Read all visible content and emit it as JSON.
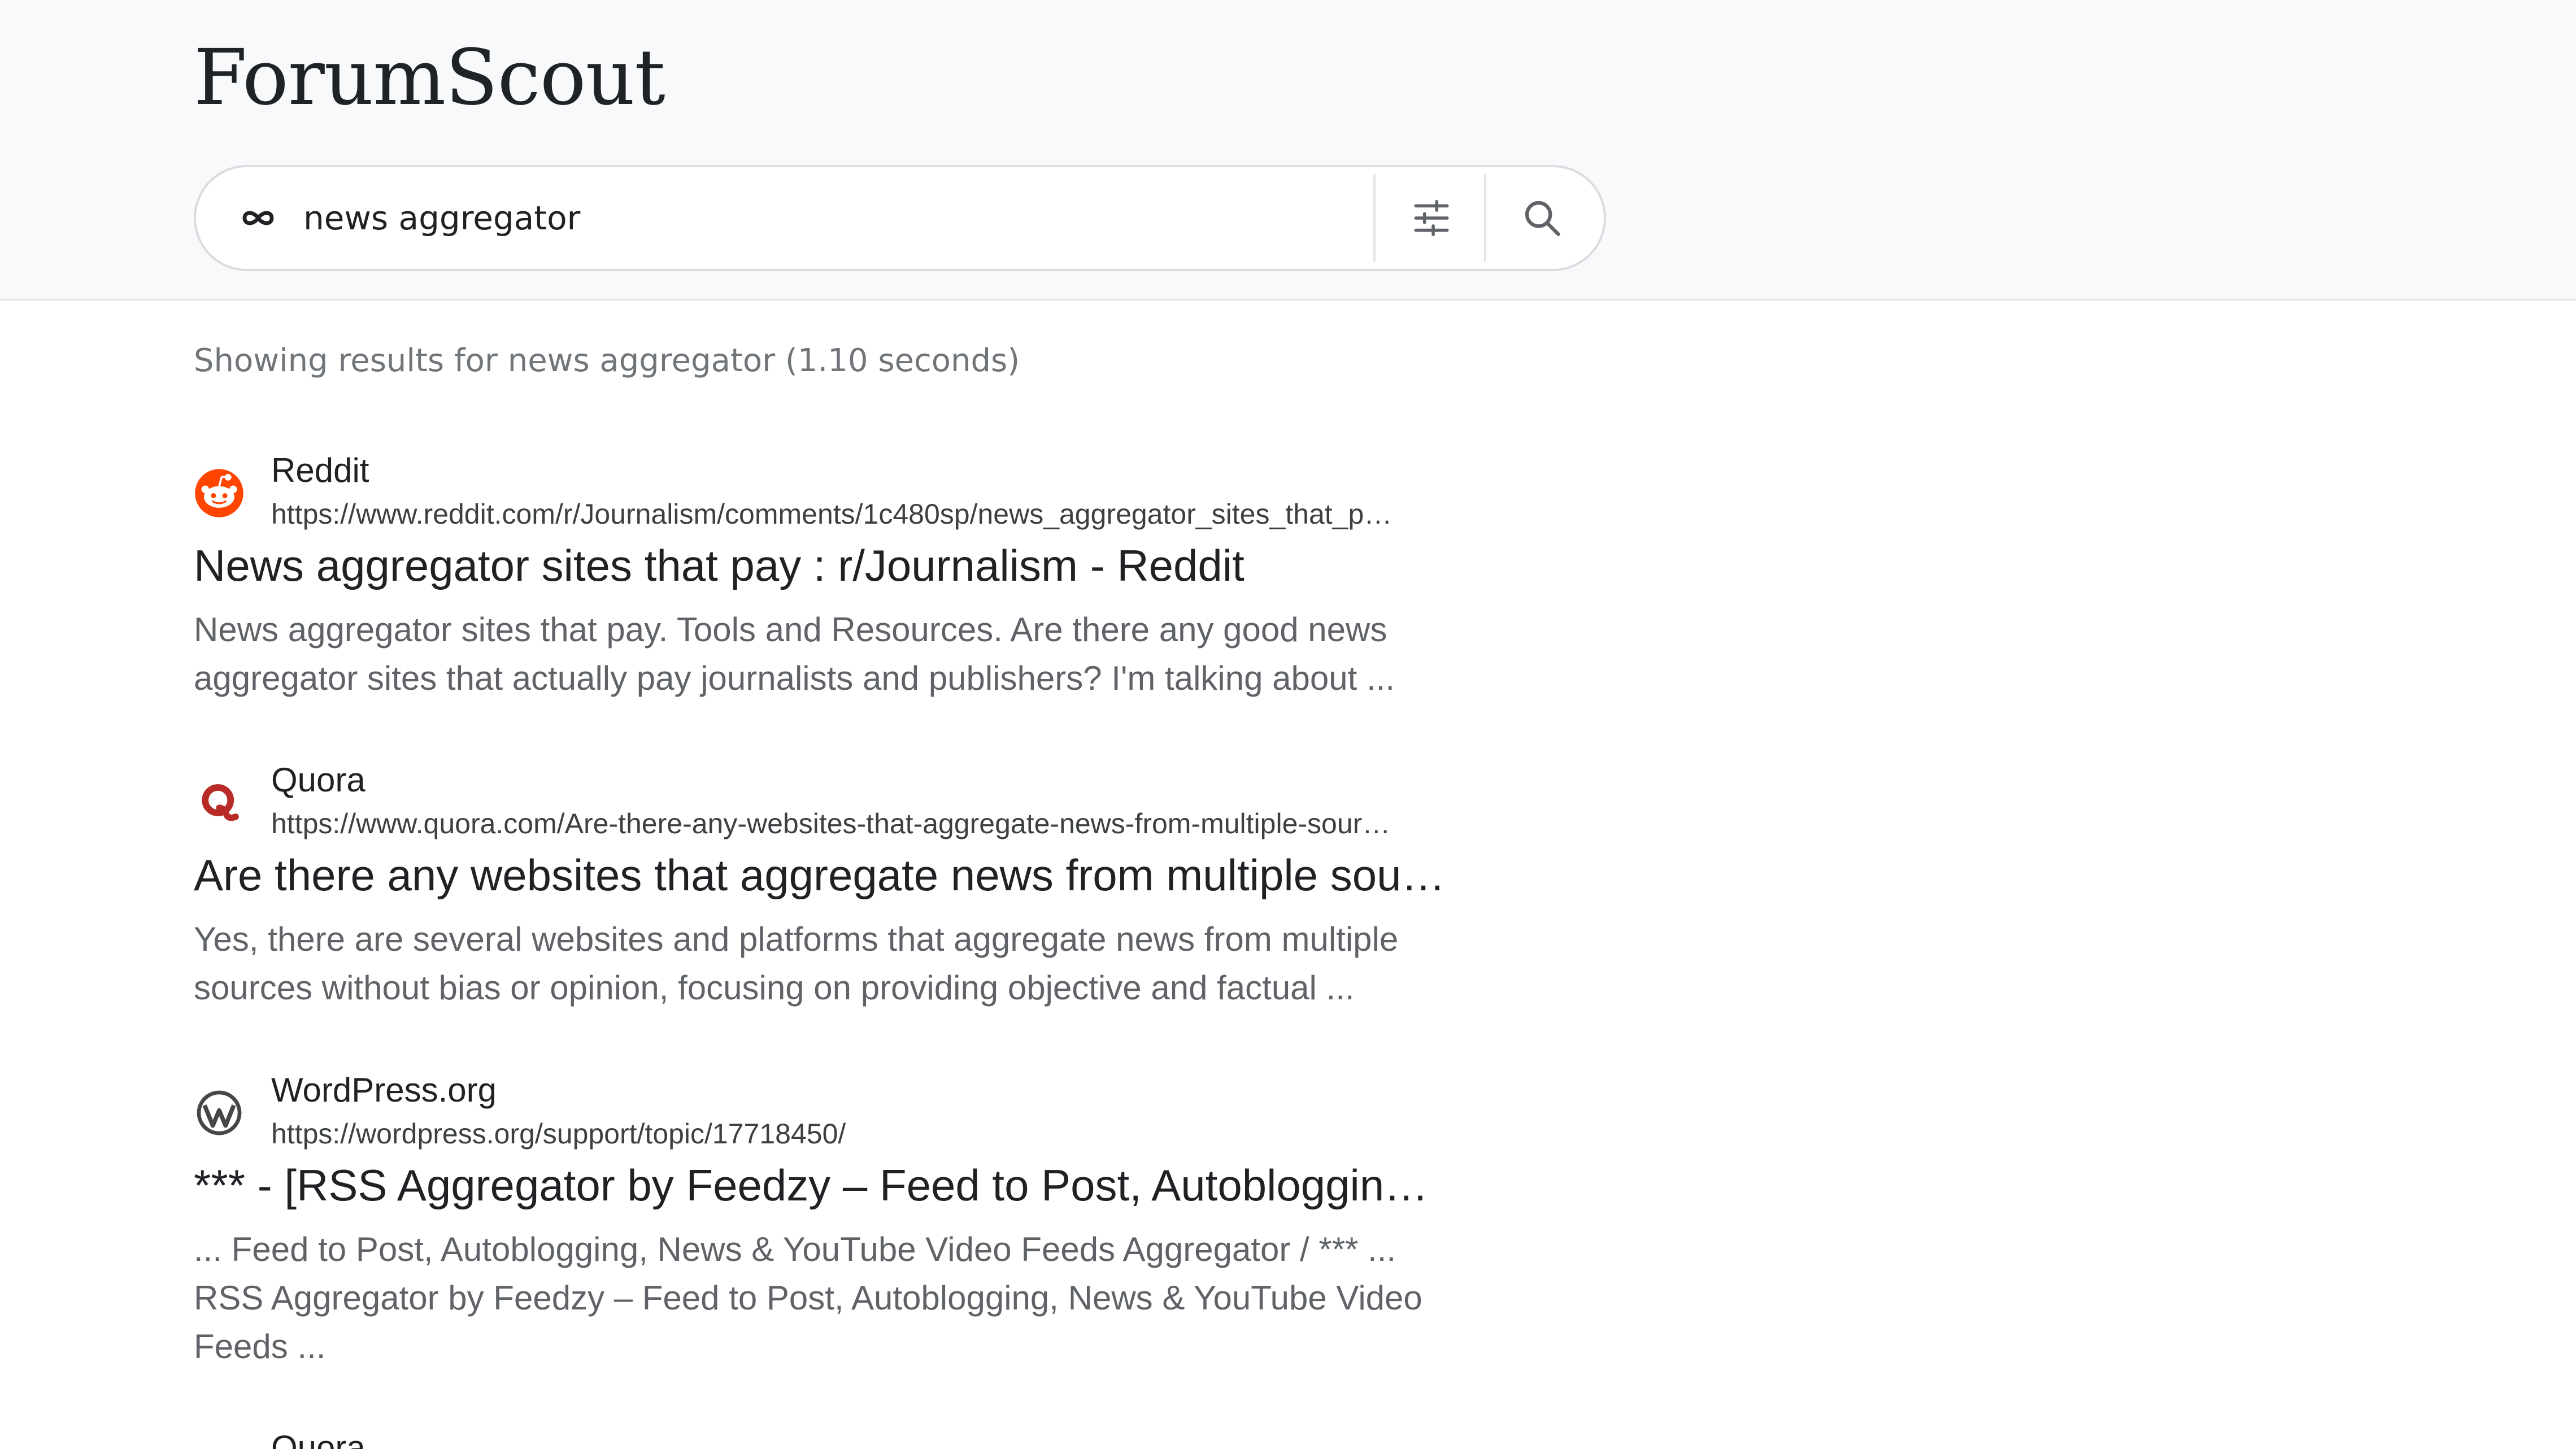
{
  "brand": "ForumScout",
  "search": {
    "query": "news aggregator",
    "icons": {
      "mode": "infinity-icon",
      "filters": "sliders-icon",
      "submit": "search-icon"
    }
  },
  "status_text": "Showing results for news aggregator (1.10 seconds)",
  "results": [
    {
      "source": "Reddit",
      "icon": "reddit-icon",
      "url": "https://www.reddit.com/r/Journalism/comments/1c480sp/news_aggregator_sites_that_p…",
      "title": "News aggregator sites that pay : r/Journalism - Reddit",
      "snippet": "News aggregator sites that pay. Tools and Resources. Are there any good news aggregator sites that actually pay journalists and publishers? I'm talking about ..."
    },
    {
      "source": "Quora",
      "icon": "quora-icon",
      "url": "https://www.quora.com/Are-there-any-websites-that-aggregate-news-from-multiple-sour…",
      "title": "Are there any websites that aggregate news from multiple sou…",
      "snippet": "Yes, there are several websites and platforms that aggregate news from multiple sources without bias or opinion, focusing on providing objective and factual ..."
    },
    {
      "source": "WordPress.org",
      "icon": "wordpress-icon",
      "url": "https://wordpress.org/support/topic/17718450/",
      "title": "*** - [RSS Aggregator by Feedzy – Feed to Post, Autobloggin…",
      "snippet": "... Feed to Post, Autoblogging, News & YouTube Video Feeds Aggregator / *** ... RSS Aggregator by Feedzy – Feed to Post, Autoblogging, News & YouTube Video Feeds ..."
    },
    {
      "source": "Quora",
      "icon": "quora-icon"
    }
  ],
  "colors": {
    "header_bg": "#f8f9fa",
    "reddit": "#ff4500",
    "quora": "#b92b27",
    "wordpress": "#464646"
  }
}
